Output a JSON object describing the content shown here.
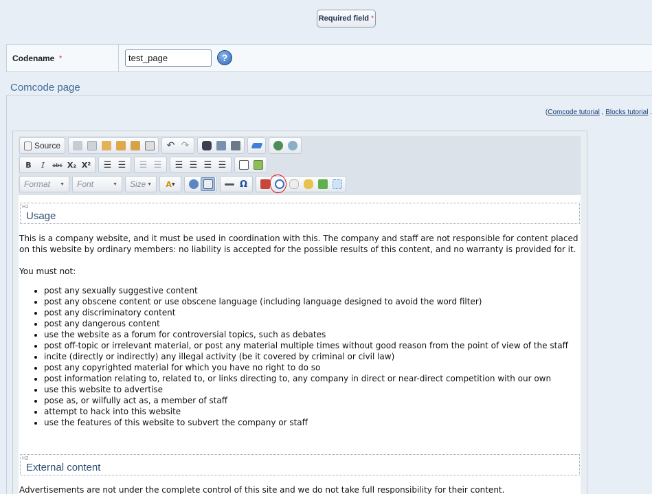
{
  "required": {
    "label": "Required field",
    "star": "*"
  },
  "codename": {
    "label": "Codename",
    "star": "*",
    "value": "test_page",
    "help": "?"
  },
  "section": {
    "title": "Comcode page"
  },
  "tutorials": {
    "open": "(",
    "comcode": "Comcode tutorial",
    "sep": ",",
    "blocks": "Blocks tutorial",
    "end": "."
  },
  "toolbar": {
    "source_label": "Source",
    "format_placeholder": "Format",
    "font_placeholder": "Font",
    "size_placeholder": "Size",
    "bold": "B",
    "italic": "I",
    "strike": "abc",
    "subscript": "X₂",
    "superscript": "X²",
    "omega": "Ω",
    "font_color": "A"
  },
  "content": {
    "h2_tag": "H2",
    "heading1": "Usage",
    "intro": "This is a company website, and it must be used in coordination with this. The company and staff are not responsible for content placed on this website by ordinary members: no liability is accepted for the possible results of this content, and no warranty is provided for it.",
    "must_not": "You must not:",
    "rules": [
      "post any sexually suggestive content",
      "post any obscene content or use obscene language (including language designed to avoid the word filter)",
      "post any discriminatory content",
      "post any dangerous content",
      "use the website as a forum for controversial topics, such as debates",
      "post off-topic or irrelevant material, or post any material multiple times without good reason from the point of view of the staff",
      "incite (directly or indirectly) any illegal activity (be it covered by criminal or civil law)",
      "post any copyrighted material for which you have no right to do so",
      "post information relating to, related to, or links directing to, any company in direct or near-direct competition with our own",
      "use this website to advertise",
      "pose as, or wilfully act as, a member of staff",
      "attempt to hack into this website",
      "use the features of this website to subvert the company or staff"
    ],
    "heading2": "External content",
    "external": "Advertisements are not under the complete control of this site and we do not take full responsibility for their content."
  }
}
